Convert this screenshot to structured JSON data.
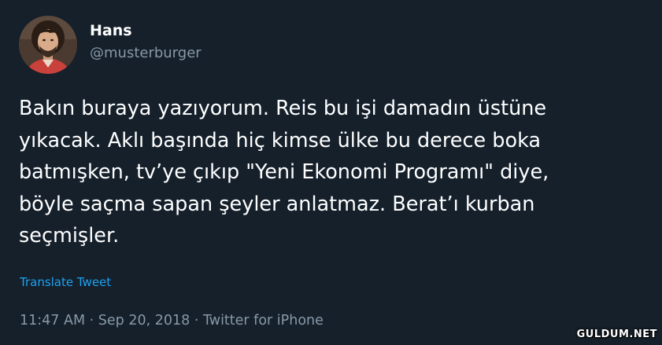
{
  "user": {
    "display_name": "Hans",
    "handle": "@musterburger"
  },
  "tweet": {
    "text": "Bakın buraya yazıyorum. Reis bu işi damadın üstüne\nyıkacak. Aklı başında hiç kimse ülke bu derece boka\nbatmışken, tv’ye çıkıp \"Yeni Ekonomi Programı\" diye,\nböyle saçma sapan şeyler anlatmaz. Berat’ı kurban\nseçmişler.",
    "translate_label": "Translate Tweet",
    "time": "11:47 AM",
    "separator": " · ",
    "date": "Sep 20, 2018",
    "source": "Twitter for iPhone"
  },
  "watermark": "GULDUM.NET",
  "colors": {
    "background": "#15202b",
    "text_primary": "#ffffff",
    "text_secondary": "#8899a6",
    "link": "#1da1f2"
  },
  "icons": {
    "avatar": "user-avatar"
  }
}
